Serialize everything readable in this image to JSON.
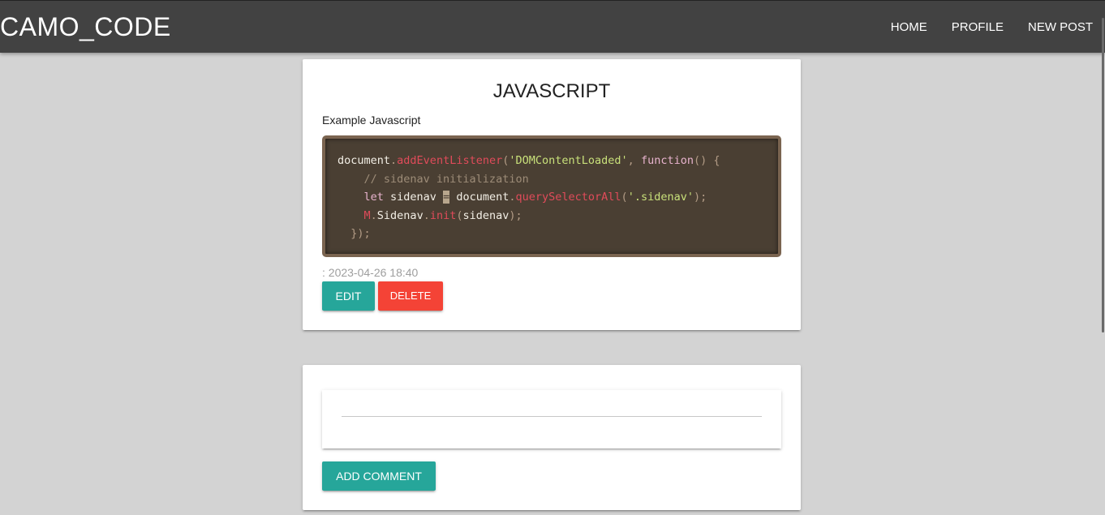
{
  "navbar": {
    "brand": "CAMO_CODE",
    "links": [
      "HOME",
      "PROFILE",
      "NEW POST"
    ]
  },
  "post": {
    "title": "JAVASCRIPT",
    "description": "Example Javascript",
    "code": {
      "line1": {
        "a": "document",
        "b": ".",
        "c": "addEventListener",
        "d": "(",
        "e": "'DOMContentLoaded'",
        "f": ", ",
        "g": "function",
        "h": "() {"
      },
      "line2": {
        "a": "    // sidenav initialization"
      },
      "line3": {
        "a": "    ",
        "b": "let",
        "c": " sidenav ",
        "d": "=",
        "e": " document",
        "f": ".",
        "g": "querySelectorAll",
        "h": "(",
        "i": "'.sidenav'",
        "j": ");"
      },
      "line4": {
        "a": "    ",
        "b": "M",
        "c": ".",
        "d": "Sidenav",
        "e": ".",
        "f": "init",
        "g": "(",
        "h": "sidenav",
        "i": ");"
      },
      "line5": {
        "a": "  });"
      }
    },
    "date": ": 2023-04-26 18:40",
    "edit_label": "EDIT",
    "delete_label": "DELETE"
  },
  "comments": {
    "input_value": "",
    "input_placeholder": "",
    "add_label": "ADD COMMENT"
  },
  "colors": {
    "navbar": "#424242",
    "background": "#d3d3d3",
    "teal": "#26a69a",
    "red": "#f44336",
    "code_bg": "#4a3f33"
  }
}
